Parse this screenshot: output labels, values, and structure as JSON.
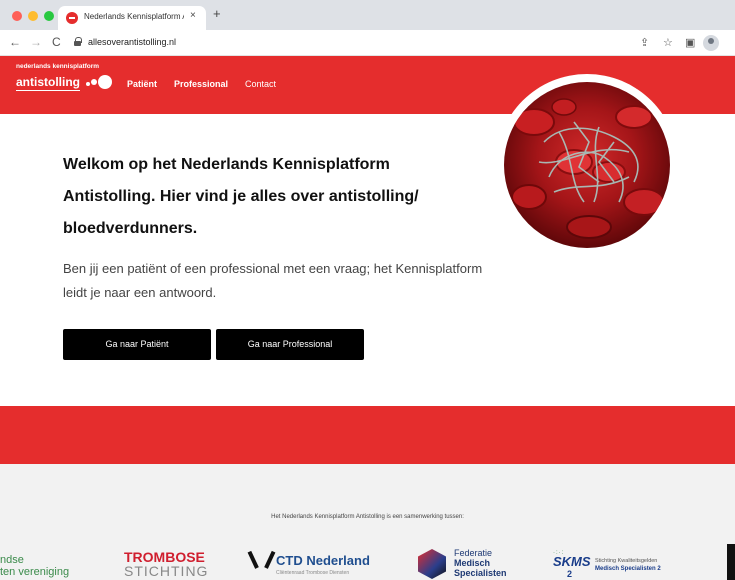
{
  "browser": {
    "tab_title": "Nederlands Kennisplatform A",
    "tab_close": "×",
    "new_tab": "+",
    "url": "allesoverantistolling.nl"
  },
  "site": {
    "logo_top": "nederlands kennisplatform",
    "logo_bottom": "antistolling",
    "nav": [
      "Patiënt",
      "Professional",
      "Contact"
    ]
  },
  "hero": {
    "headline": "Welkom op het Nederlands Kennisplatform Antistolling. Hier vind je alles over antistolling/ bloedverdunners.",
    "subtext": "Ben jij een patiënt of een professional met een vraag; het Kennisplatform leidt je naar een antwoord.",
    "button_patient": "Ga naar Patiënt",
    "button_professional": "Ga naar Professional"
  },
  "partners": {
    "caption": "Het Nederlands Kennisplatform Antistolling is een samenwerking tussen:",
    "logo1_line1": "ndse",
    "logo1_line2": "ten vereniging",
    "trombose_a": "TROMBOSE",
    "trombose_b": "STICHTING",
    "ctd_name": "CTD Nederland",
    "ctd_sub": "Cliëntenraad Trombose Diensten",
    "fms_1": "Federatie",
    "fms_2": "Medisch",
    "fms_3": "Specialisten",
    "skms_name": "SKMS",
    "skms_2": "2",
    "skms_t1": "Stichting Kwaliteitsgelden",
    "skms_t2": "Medisch Specialisten 2"
  },
  "colors": {
    "brand_red": "#e52d2d",
    "button_black": "#000000"
  }
}
